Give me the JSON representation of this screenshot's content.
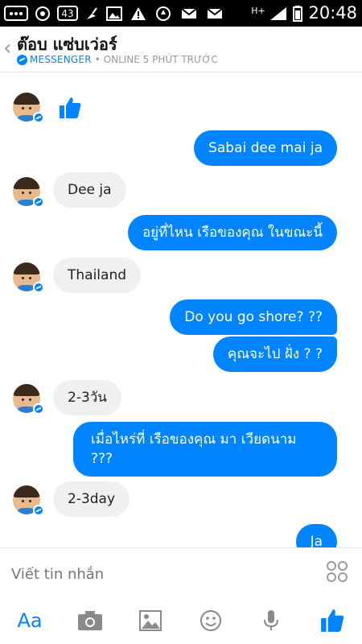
{
  "status_bar": {
    "notification_count": "43",
    "network": "H+",
    "time": "20:48"
  },
  "header": {
    "back_icon": "chevron-left-icon",
    "contact_name": "ต๊อบ แซ่บเว่อร์",
    "app_label": "MESSENGER",
    "status_text": "• ONLINE 5 PHÚT TRƯỚC"
  },
  "messages": [
    {
      "side": "in",
      "type": "like"
    },
    {
      "side": "out",
      "text": "Sabai dee mai ja"
    },
    {
      "side": "in",
      "text": "Dee ja"
    },
    {
      "side": "out",
      "text": "อยู่ที่ไหน เรือของคุณ ในขณะนี้"
    },
    {
      "side": "in",
      "text": "Thailand"
    },
    {
      "side": "out",
      "text": "Do you go shore? ??"
    },
    {
      "side": "out",
      "text": "คุณจะไป ฝั่ง ? ?"
    },
    {
      "side": "in",
      "text": "2-3วัน"
    },
    {
      "side": "out",
      "text": "เมื่อไหร่ที่ เรือของคุณ มา เวียดนาม ???"
    },
    {
      "side": "in",
      "text": "2-3day"
    },
    {
      "side": "out",
      "text": "Ja"
    }
  ],
  "composer": {
    "placeholder": "Viết tin nhắn"
  },
  "toolbar": {
    "text_button_label": "Aa"
  },
  "colors": {
    "accent": "#0084ff",
    "incoming_bubble": "#f0f0f0",
    "status_bar": "#000000"
  }
}
